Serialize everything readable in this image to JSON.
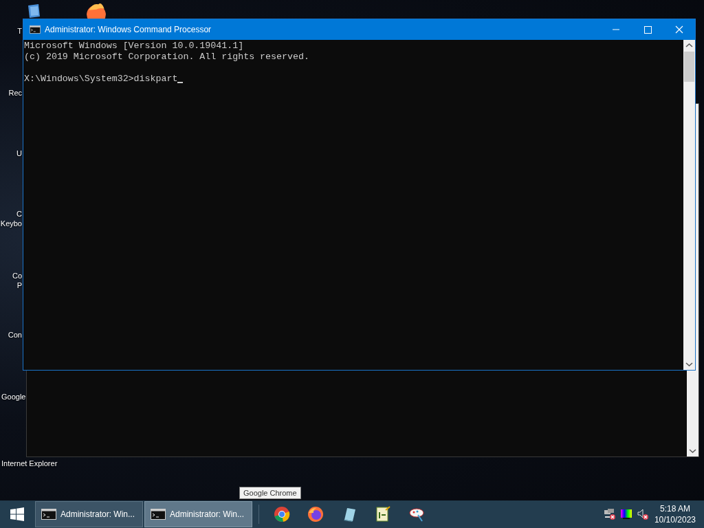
{
  "desktop_icons": [
    {
      "kind": "folder"
    },
    {
      "kind": "firefox"
    }
  ],
  "desktop_labels": [
    "T",
    "Rec",
    "U",
    "C\nKeybo",
    "Co\nP",
    "Con",
    "Google",
    "Internet Explorer"
  ],
  "window": {
    "title": "Administrator: Windows Command Processor",
    "paragraphs": [
      [
        "Microsoft Windows [Version 10.0.19041.1]",
        "(c) 2019 Microsoft Corporation. All rights reserved."
      ],
      [
        "X:\\Windows\\System32>diskpart"
      ]
    ]
  },
  "tooltip": "Google Chrome",
  "taskbar": {
    "tasks": [
      {
        "label": "Administrator: Win...",
        "selected": false
      },
      {
        "label": "Administrator: Win...",
        "selected": true
      }
    ],
    "pinned": [
      {
        "kind": "chrome"
      },
      {
        "kind": "firefox"
      },
      {
        "kind": "notepad"
      },
      {
        "kind": "editor"
      },
      {
        "kind": "paint"
      }
    ],
    "tray": [
      {
        "kind": "network"
      },
      {
        "kind": "display"
      },
      {
        "kind": "volume"
      }
    ],
    "time": "5:18 AM",
    "date": "10/10/2023"
  }
}
